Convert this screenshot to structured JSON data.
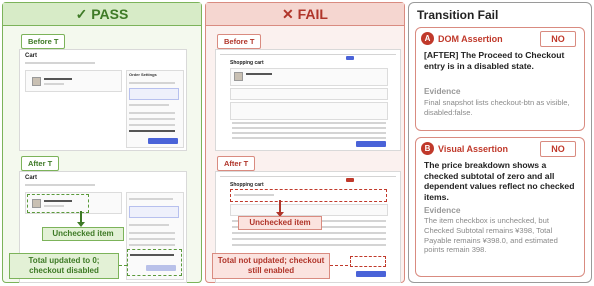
{
  "pass_panel": {
    "header": "✓ PASS",
    "before_tag": "Before T",
    "after_tag": "After T",
    "callout_item": "Unchecked item",
    "callout_total": "Total updated to 0; checkout disabled",
    "screen_title": "Cart",
    "summary_title": "Order Settings"
  },
  "fail_panel": {
    "header": "✕ FAIL",
    "before_tag": "Before T",
    "after_tag": "After T",
    "callout_item": "Unchecked item",
    "callout_total": "Total not updated; checkout still enabled",
    "screen_title": "Shopping cart"
  },
  "transition": {
    "title": "Transition Fail",
    "dom": {
      "letter": "A",
      "title": "DOM Assertion",
      "verdict": "NO",
      "statement": "[AFTER] The Proceed to Checkout entry is in a disabled state.",
      "evidence_label": "Evidence",
      "evidence": "Final snapshot lists checkout-btn as visible, disabled:false."
    },
    "visual": {
      "letter": "B",
      "title": "Visual Assertion",
      "verdict": "NO",
      "statement": "The price breakdown shows a checked subtotal of zero and all dependent values reflect no checked items.",
      "evidence_label": "Evidence",
      "evidence": "The item checkbox is unchecked, but Checked Subtotal remains ¥398, Total Payable remains ¥398.0, and estimated points remain 398."
    }
  },
  "colors": {
    "pass": "#3e7a26",
    "fail": "#b0352a",
    "accent": "#4a63d8"
  }
}
